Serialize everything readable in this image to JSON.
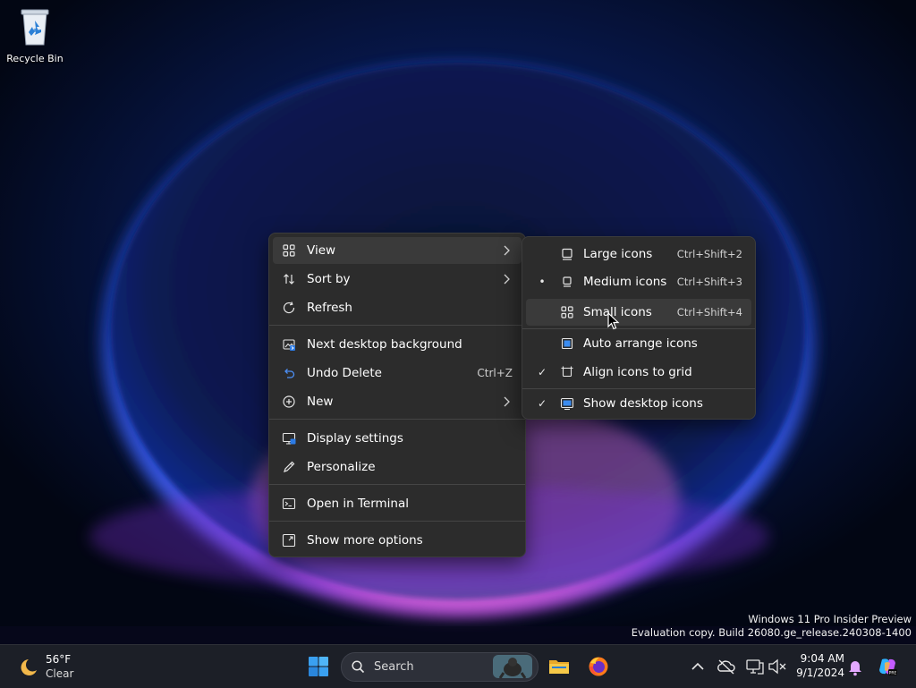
{
  "desktop": {
    "recycle_bin_label": "Recycle Bin",
    "watermark_line1": "Windows 11 Pro Insider Preview",
    "watermark_line2": "Evaluation copy. Build 26080.ge_release.240308-1400"
  },
  "context_menu": {
    "items": [
      {
        "label": "View",
        "icon": "view-grid-icon",
        "submenu": true
      },
      {
        "label": "Sort by",
        "icon": "sort-icon",
        "submenu": true
      },
      {
        "label": "Refresh",
        "icon": "refresh-icon"
      },
      {
        "label": "Next desktop background",
        "icon": "next-background-icon"
      },
      {
        "label": "Undo Delete",
        "icon": "undo-icon",
        "shortcut": "Ctrl+Z"
      },
      {
        "label": "New",
        "icon": "new-plus-icon",
        "submenu": true
      },
      {
        "label": "Display settings",
        "icon": "display-icon"
      },
      {
        "label": "Personalize",
        "icon": "pen-icon"
      },
      {
        "label": "Open in Terminal",
        "icon": "terminal-icon"
      },
      {
        "label": "Show more options",
        "icon": "more-options-icon"
      }
    ]
  },
  "view_submenu": {
    "items": [
      {
        "label": "Large icons",
        "shortcut": "Ctrl+Shift+2",
        "mark": "",
        "icon": "large-icons-icon"
      },
      {
        "label": "Medium icons",
        "shortcut": "Ctrl+Shift+3",
        "mark": "•",
        "icon": "medium-icons-icon"
      },
      {
        "label": "Small icons",
        "shortcut": "Ctrl+Shift+4",
        "mark": "",
        "icon": "small-icons-icon"
      },
      {
        "label": "Auto arrange icons",
        "mark": "",
        "icon": "auto-arrange-icon"
      },
      {
        "label": "Align icons to grid",
        "mark": "✓",
        "icon": "align-grid-icon"
      },
      {
        "label": "Show desktop icons",
        "mark": "✓",
        "icon": "show-desktop-icon"
      }
    ]
  },
  "taskbar": {
    "weather": {
      "temp": "56°F",
      "condition": "Clear",
      "icon": "moon-icon"
    },
    "search_placeholder": "Search",
    "apps": [
      "start-icon",
      "file-explorer-icon",
      "firefox-icon"
    ],
    "tray": [
      "chevron-up-icon",
      "onedrive-icon",
      "network-icon",
      "volume-muted-icon",
      "notification-bell-icon",
      "copilot-icon"
    ],
    "time": "9:04 AM",
    "date": "9/1/2024"
  },
  "colors": {
    "menu_bg": "#2c2c2c",
    "menu_highlight": "#3a3a3a",
    "taskbar_bg": "#1c1f27"
  }
}
